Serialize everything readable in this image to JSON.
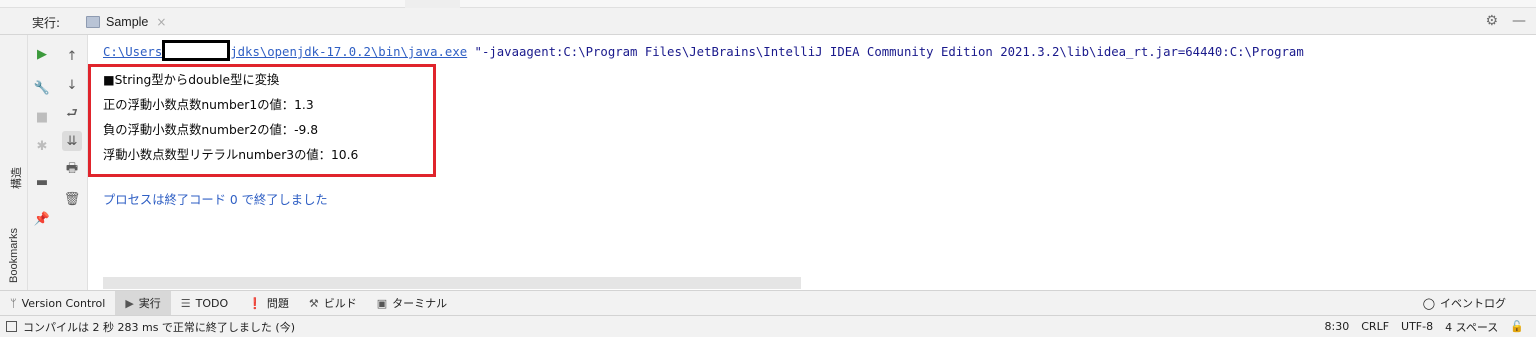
{
  "run_header": {
    "label": "実行:",
    "tab_title": "Sample",
    "tab_close": "×",
    "settings_icon": "gear-icon",
    "minimize_icon": "minus-icon"
  },
  "left_stripe": {
    "structure_label": "構造",
    "bookmarks_label": "Bookmarks"
  },
  "console": {
    "command": {
      "path_prefix": "C:\\Users",
      "path_suffix": "jdks\\openjdk-17.0.2\\bin\\java.exe",
      "args": " \"-javaagent:C:\\Program Files\\JetBrains\\IntelliJ IDEA Community Edition 2021.3.2\\lib\\idea_rt.jar=64440:C:\\Program"
    },
    "output_lines": [
      "■String型からdouble型に変換",
      "正の浮動小数点数number1の値：1.3",
      "負の浮動小数点数number2の値：-9.8",
      "浮動小数点数型リテラルnumber3の値：10.6"
    ],
    "exit_message": "プロセスは終了コード 0 で終了しました"
  },
  "bottom_tools": {
    "items": [
      {
        "icon": "branch-icon",
        "label": "Version Control"
      },
      {
        "icon": "play-icon",
        "label": "実行",
        "active": true
      },
      {
        "icon": "list-icon",
        "label": "TODO"
      },
      {
        "icon": "problem-icon",
        "label": "問題"
      },
      {
        "icon": "hammer-icon",
        "label": "ビルド"
      },
      {
        "icon": "terminal-icon",
        "label": "ターミナル"
      }
    ],
    "event_log": "イベントログ"
  },
  "status_bar": {
    "message": "コンパイルは 2 秒 283 ms で正常に終了しました (今)",
    "position": "8:30",
    "line_ending": "CRLF",
    "encoding": "UTF-8",
    "indent": "4 スペース"
  }
}
